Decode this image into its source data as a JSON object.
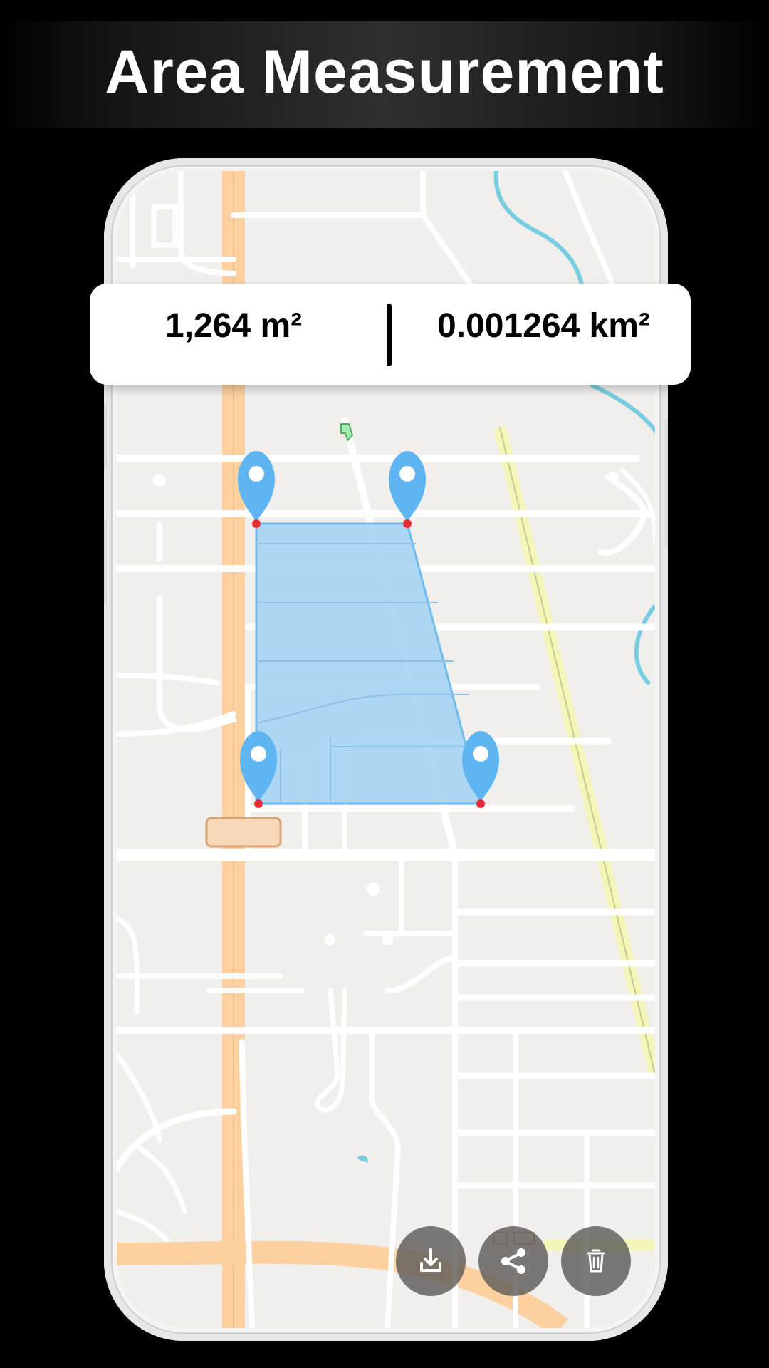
{
  "header": {
    "title": "Area Measurement"
  },
  "measurement": {
    "square_meters": "1,264 m²",
    "square_kilometers": "0.001264 km²"
  },
  "colors": {
    "background": "#000000",
    "map_base": "#f1efec",
    "road_major": "#fcd09f",
    "road_secondary": "#f3f6b8",
    "water": "#79cde0",
    "selection_fill": "#a9d5f3",
    "selection_stroke": "#6bb8ec",
    "marker": "#5fb4f2",
    "marker_tip": "#e52d36",
    "action_button": "#5f5c58"
  },
  "actions": [
    {
      "icon": "download-icon"
    },
    {
      "icon": "share-icon"
    },
    {
      "icon": "trash-icon"
    }
  ]
}
